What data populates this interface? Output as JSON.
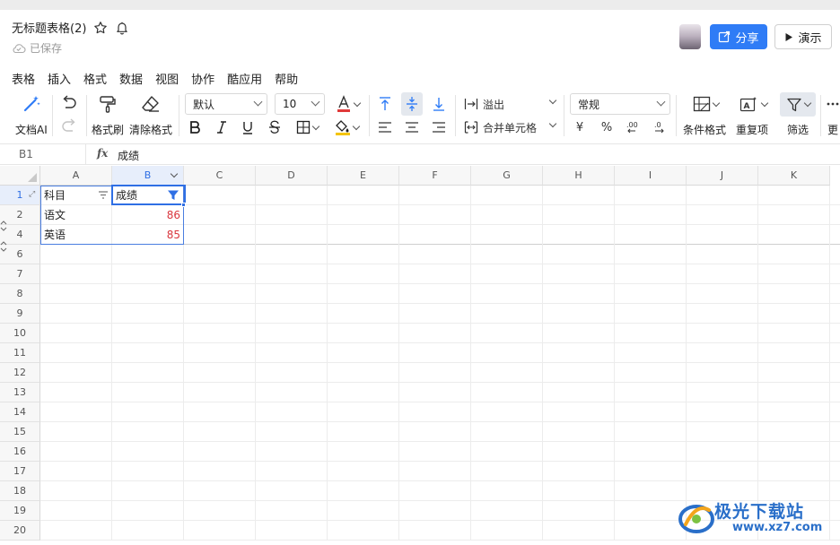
{
  "header": {
    "title": "无标题表格(2)",
    "saved_status": "已保存",
    "share_label": "分享",
    "present_label": "演示"
  },
  "menu": [
    "表格",
    "插入",
    "格式",
    "数据",
    "视图",
    "协作",
    "酷应用",
    "帮助"
  ],
  "toolbar": {
    "ai_label": "文档AI",
    "format_painter_label": "格式刷",
    "clear_format_label": "清除格式",
    "font_name": "默认",
    "font_size": "10",
    "overflow_label": "溢出",
    "merge_label": "合并单元格",
    "number_format": "常规",
    "currency_symbol": "¥",
    "percent_symbol": "%",
    "cond_format_label": "条件格式",
    "duplicate_label": "重复项",
    "filter_label": "筛选",
    "more_label": "更"
  },
  "formula_bar": {
    "cell_ref": "B1",
    "fx": "fx",
    "value": "成绩"
  },
  "grid": {
    "columns": [
      "A",
      "B",
      "C",
      "D",
      "E",
      "F",
      "G",
      "H",
      "I",
      "J",
      "K"
    ],
    "rows": [
      "1",
      "2",
      "4",
      "6",
      "7",
      "8",
      "9",
      "10",
      "11",
      "12",
      "13",
      "14",
      "15",
      "16",
      "17",
      "18",
      "19",
      "20"
    ],
    "cells": {
      "A1": "科目",
      "B1": "成绩",
      "A2": "语文",
      "B2": "86",
      "A4": "英语",
      "B4": "85"
    }
  },
  "colors": {
    "accent": "#2f7cf6",
    "value_red": "#d9363e",
    "selection": "#2f6fe4"
  },
  "watermark": {
    "text": "极光下载站",
    "url": "www.xz7.com"
  }
}
